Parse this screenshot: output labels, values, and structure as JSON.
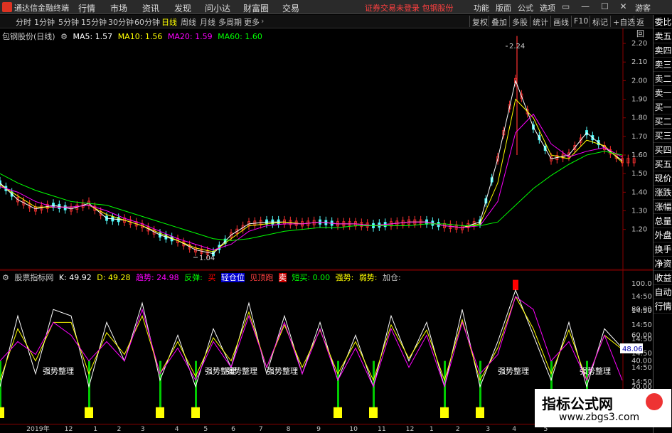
{
  "app": {
    "name": "通达信金融终端",
    "menus": [
      "行情",
      "市场",
      "资讯",
      "发现",
      "问小达",
      "财富圈",
      "交易"
    ],
    "notice": "证券交易未登录  包钢股份",
    "right_menus": [
      "功能",
      "版面",
      "公式",
      "选项"
    ],
    "guest": "游客"
  },
  "toolbar": {
    "periods": [
      "分时",
      "1分钟",
      "5分钟",
      "15分钟",
      "30分钟",
      "60分钟",
      "日线",
      "周线",
      "月线",
      "多周期",
      "更多"
    ],
    "active_period": "日线",
    "right_buttons": [
      "复权",
      "叠加",
      "多股",
      "统计",
      "画线",
      "F10",
      "标记",
      "+自选",
      "返回"
    ]
  },
  "side_panel": [
    "委比",
    "卖五",
    "卖四",
    "卖三",
    "卖二",
    "卖一",
    "买一",
    "买二",
    "买三",
    "买四",
    "买五",
    "现价",
    "涨跌",
    "涨幅",
    "总量",
    "外盘",
    "换手",
    "净资",
    "收益",
    "自动",
    "行情",
    "",
    "",
    "",
    "",
    "",
    "",
    ""
  ],
  "main_legend": {
    "title": "包钢股份(日线)",
    "ma5": "MA5: 1.57",
    "ma10": "MA10: 1.56",
    "ma20": "MA20: 1.59",
    "ma60": "MA60: 1.60"
  },
  "main_annotations": {
    "high": "2.24",
    "low": "1.04"
  },
  "main_axis": [
    "2.20",
    "2.10",
    "2.00",
    "1.90",
    "1.80",
    "1.70",
    "1.60",
    "1.50",
    "1.40",
    "1.30",
    "1.20"
  ],
  "ind_legend": {
    "name": "股票指标网",
    "k": "K: 49.92",
    "d": "D: 49.28",
    "trend": "趋势: 24.98",
    "rebound": "反弹:",
    "buy": "买",
    "low_pos": "轻仓位",
    "see_top": "见顶跑",
    "sell": "卖",
    "short_buy": "短买: 0.00",
    "strong": "强势:",
    "weak": "弱势:",
    "add": "加仓:"
  },
  "ind_axis": [
    "100.0",
    "80.00",
    "60.00",
    "40.00",
    "20.00"
  ],
  "ind_time_labels": [
    "14:50",
    "14:50",
    "14:50",
    "14:50",
    "14:50",
    "14:50",
    "14:50"
  ],
  "ind_current": "48.06",
  "ind_annotations": [
    "强势整理",
    "强势整理",
    "强势整理",
    "强势整理",
    "强势整理",
    "强势整理"
  ],
  "x_axis": [
    "2019年",
    "12",
    "1",
    "2",
    "3",
    "4",
    "5",
    "6",
    "7",
    "8",
    "9",
    "10",
    "11",
    "12",
    "1",
    "2",
    "3",
    "4",
    "5"
  ],
  "watermark": {
    "line1": "指标公式网",
    "line2": "www.zbgs3.com"
  },
  "colors": {
    "ma5": "#ffffff",
    "ma10": "#ffff00",
    "ma20": "#ff00ff",
    "ma60": "#00ff00",
    "up": "#ff3232",
    "down": "#54fcfc",
    "trend": "#ff00ff",
    "label_buy": "#ff0000"
  },
  "chart_data": [
    {
      "type": "line",
      "title": "包钢股份(日线)",
      "ylim": [
        1.0,
        2.25
      ],
      "x": [
        0,
        10,
        20,
        30,
        40,
        50,
        60,
        70,
        80,
        90,
        100,
        110,
        120,
        130,
        140,
        150,
        160,
        170,
        180,
        190,
        200,
        210,
        220,
        230,
        240,
        250,
        260,
        270,
        280,
        290,
        300,
        310,
        320,
        330,
        340,
        350
      ],
      "series": [
        {
          "name": "MA5",
          "values": [
            1.45,
            1.36,
            1.31,
            1.33,
            1.31,
            1.34,
            1.26,
            1.25,
            1.22,
            1.17,
            1.14,
            1.09,
            1.07,
            1.17,
            1.23,
            1.24,
            1.24,
            1.23,
            1.24,
            1.23,
            1.23,
            1.22,
            1.23,
            1.24,
            1.24,
            1.22,
            1.21,
            1.24,
            1.58,
            2.0,
            1.75,
            1.58,
            1.6,
            1.72,
            1.64,
            1.57
          ]
        },
        {
          "name": "MA10",
          "values": [
            1.44,
            1.38,
            1.32,
            1.32,
            1.32,
            1.33,
            1.28,
            1.25,
            1.22,
            1.18,
            1.14,
            1.1,
            1.08,
            1.15,
            1.22,
            1.23,
            1.24,
            1.23,
            1.24,
            1.23,
            1.23,
            1.22,
            1.23,
            1.24,
            1.24,
            1.22,
            1.21,
            1.23,
            1.45,
            1.9,
            1.8,
            1.6,
            1.58,
            1.68,
            1.65,
            1.56
          ]
        },
        {
          "name": "MA20",
          "values": [
            1.43,
            1.4,
            1.35,
            1.32,
            1.32,
            1.33,
            1.3,
            1.26,
            1.23,
            1.19,
            1.15,
            1.12,
            1.09,
            1.12,
            1.19,
            1.22,
            1.23,
            1.23,
            1.24,
            1.23,
            1.23,
            1.22,
            1.23,
            1.24,
            1.24,
            1.22,
            1.21,
            1.22,
            1.35,
            1.72,
            1.82,
            1.66,
            1.59,
            1.62,
            1.64,
            1.59
          ]
        },
        {
          "name": "MA60",
          "values": [
            1.5,
            1.45,
            1.41,
            1.38,
            1.35,
            1.34,
            1.33,
            1.3,
            1.27,
            1.24,
            1.21,
            1.18,
            1.15,
            1.14,
            1.15,
            1.17,
            1.19,
            1.2,
            1.21,
            1.21,
            1.22,
            1.22,
            1.22,
            1.22,
            1.23,
            1.23,
            1.22,
            1.22,
            1.24,
            1.33,
            1.42,
            1.49,
            1.55,
            1.6,
            1.62,
            1.6
          ]
        }
      ]
    },
    {
      "type": "line",
      "title": "股票指标网",
      "ylim": [
        0,
        105
      ],
      "x": [
        0,
        10,
        20,
        30,
        40,
        50,
        60,
        70,
        80,
        90,
        100,
        110,
        120,
        130,
        140,
        150,
        160,
        170,
        180,
        190,
        200,
        210,
        220,
        230,
        240,
        250,
        260,
        270,
        280,
        290,
        300,
        310,
        320,
        330,
        340,
        350
      ],
      "series": [
        {
          "name": "K",
          "values": [
            20,
            75,
            30,
            80,
            75,
            20,
            70,
            40,
            85,
            25,
            60,
            20,
            65,
            35,
            85,
            30,
            75,
            30,
            70,
            25,
            60,
            20,
            75,
            40,
            70,
            20,
            80,
            20,
            55,
            95,
            60,
            25,
            70,
            20,
            65,
            50
          ]
        },
        {
          "name": "D",
          "values": [
            25,
            65,
            40,
            70,
            70,
            30,
            62,
            45,
            75,
            30,
            55,
            28,
            58,
            40,
            78,
            35,
            68,
            35,
            64,
            30,
            55,
            25,
            68,
            42,
            64,
            25,
            72,
            25,
            50,
            90,
            65,
            30,
            64,
            25,
            60,
            49
          ]
        },
        {
          "name": "趋势",
          "values": [
            40,
            55,
            45,
            70,
            60,
            40,
            55,
            40,
            80,
            30,
            50,
            25,
            55,
            35,
            75,
            35,
            70,
            30,
            65,
            25,
            50,
            20,
            65,
            35,
            60,
            20,
            70,
            30,
            45,
            90,
            80,
            40,
            55,
            25,
            60,
            25
          ]
        }
      ]
    }
  ]
}
